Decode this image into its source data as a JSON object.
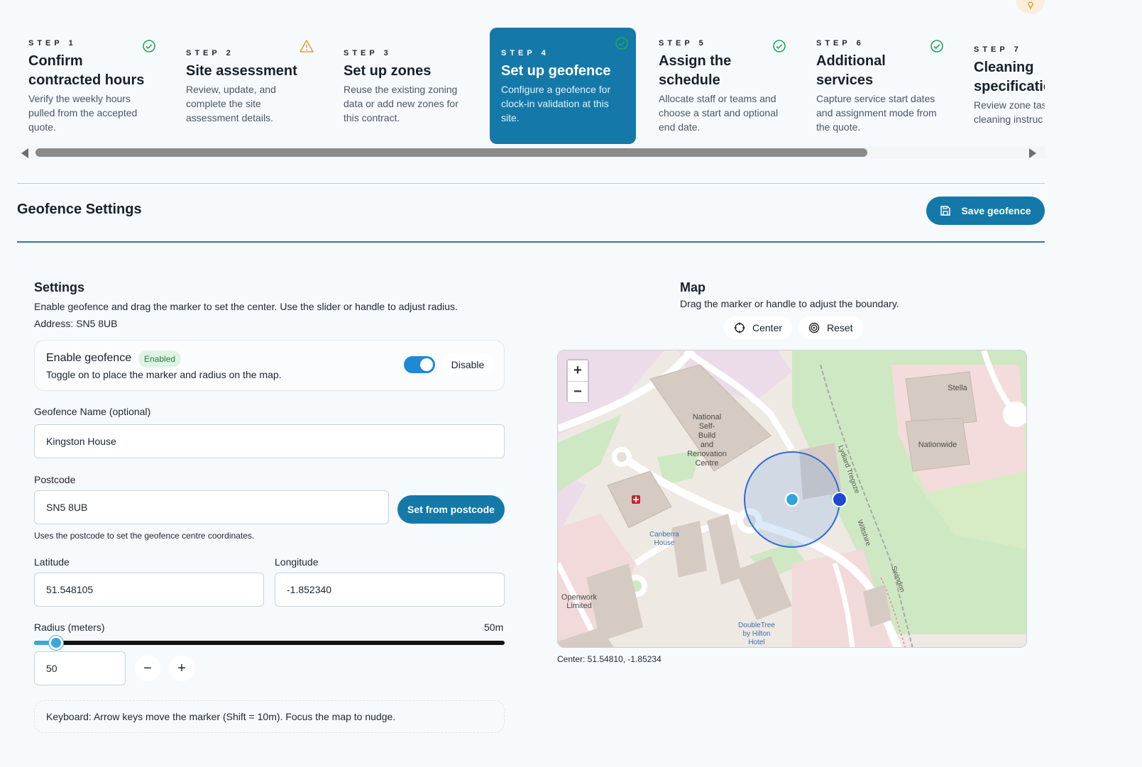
{
  "steps": [
    {
      "label": "STEP 1",
      "title": "Confirm contracted hours",
      "desc": "Verify the weekly hours pulled from the accepted quote.",
      "status": "complete"
    },
    {
      "label": "STEP 2",
      "title": "Site assessment",
      "desc": "Review, update, and complete the site assessment details.",
      "status": "warning"
    },
    {
      "label": "STEP 3",
      "title": "Set up zones",
      "desc": "Reuse the existing zoning data or add new zones for this contract.",
      "status": "none"
    },
    {
      "label": "STEP 4",
      "title": "Set up geofence",
      "desc": "Configure a geofence for clock-in validation at this site.",
      "status": "complete-active"
    },
    {
      "label": "STEP 5",
      "title": "Assign the schedule",
      "desc": "Allocate staff or teams and choose a start and optional end date.",
      "status": "complete"
    },
    {
      "label": "STEP 6",
      "title": "Additional services",
      "desc": "Capture service start dates and assignment mode from the quote.",
      "status": "complete"
    },
    {
      "label": "STEP 7",
      "title": "Cleaning specificatio",
      "desc": "Review zone tas cleaning instruc",
      "status": "none"
    }
  ],
  "header": {
    "title": "Geofence Settings",
    "save_label": "Save geofence"
  },
  "settings": {
    "title": "Settings",
    "intro": "Enable geofence and drag the marker to set the center. Use the slider or handle to adjust radius.",
    "address": "Address: SN5 8UB",
    "enable_title": "Enable geofence",
    "enable_badge": "Enabled",
    "enable_sub": "Toggle on to place the marker and radius on the map.",
    "enabled": true,
    "disable_label": "Disable",
    "name_label": "Geofence Name (optional)",
    "name_value": "Kingston House",
    "postcode_label": "Postcode",
    "postcode_value": "SN5 8UB",
    "postcode_btn": "Set from postcode",
    "postcode_help": "Uses the postcode to set the geofence centre coordinates.",
    "lat_label": "Latitude",
    "lat_value": "51.548105",
    "lng_label": "Longitude",
    "lng_value": "-1.852340",
    "radius_label": "Radius (meters)",
    "radius_display": "50m",
    "radius_value": "50",
    "radius_min": 0,
    "radius_max": 1000,
    "minus": "−",
    "plus": "+",
    "keyboard_hint": "Keyboard: Arrow keys move the marker (Shift = 10m). Focus the map to nudge."
  },
  "map": {
    "title": "Map",
    "subtitle": "Drag the marker or handle to adjust the boundary.",
    "center_btn": "Center",
    "reset_btn": "Reset",
    "zoom_in": "+",
    "zoom_out": "−",
    "center_readout": "Center: 51.54810, -1.85234",
    "labels": {
      "national": [
        "National",
        "Self-",
        "Build",
        "and",
        "Renovation",
        "Centre"
      ],
      "stella": "Stella",
      "nationwide": "Nationwide",
      "canberra": [
        "Canberra",
        "House"
      ],
      "openwork": [
        "Openwork",
        "Limited"
      ],
      "doubletree": [
        "DoubleTree",
        "by Hilton",
        "Hotel"
      ],
      "lydiard": "Lydiard Tregoze",
      "wiltshire": "Wiltshire",
      "swindon": "Swindon"
    }
  },
  "colors": {
    "primary": "#1479a9",
    "success": "#22a55b",
    "warning": "#e0a12a"
  }
}
